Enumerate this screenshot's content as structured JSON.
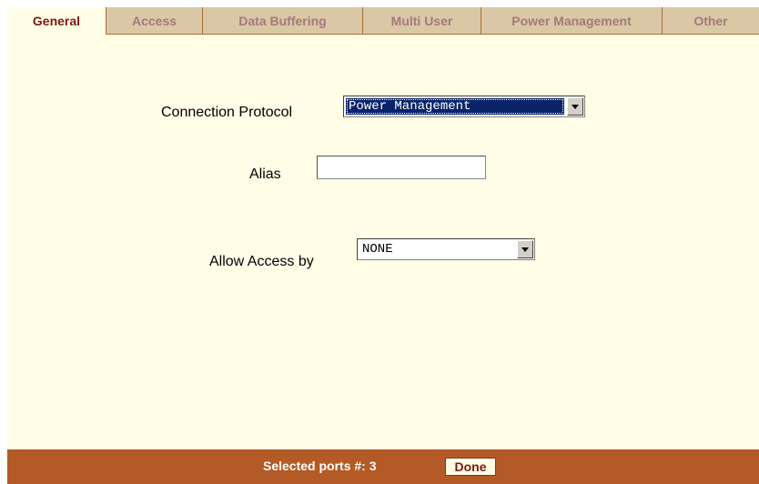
{
  "tabs": [
    {
      "label": "General",
      "active": true
    },
    {
      "label": "Access",
      "active": false
    },
    {
      "label": "Data Buffering",
      "active": false
    },
    {
      "label": "Multi User",
      "active": false
    },
    {
      "label": "Power Management",
      "active": false
    },
    {
      "label": "Other",
      "active": false
    }
  ],
  "form": {
    "connection_protocol": {
      "label": "Connection Protocol",
      "value": "Power Management"
    },
    "alias": {
      "label": "Alias",
      "value": ""
    },
    "allow_access_by": {
      "label": "Allow Access by",
      "value": "NONE"
    }
  },
  "footer": {
    "selected_ports": "Selected ports #: 3",
    "done_label": "Done"
  },
  "colors": {
    "panel_bg": "#fffde6",
    "tab_bg": "#d9c7a6",
    "active_tab_text": "#7a1a12",
    "footer_bg": "#b35a26",
    "selection": "#0a246a"
  }
}
